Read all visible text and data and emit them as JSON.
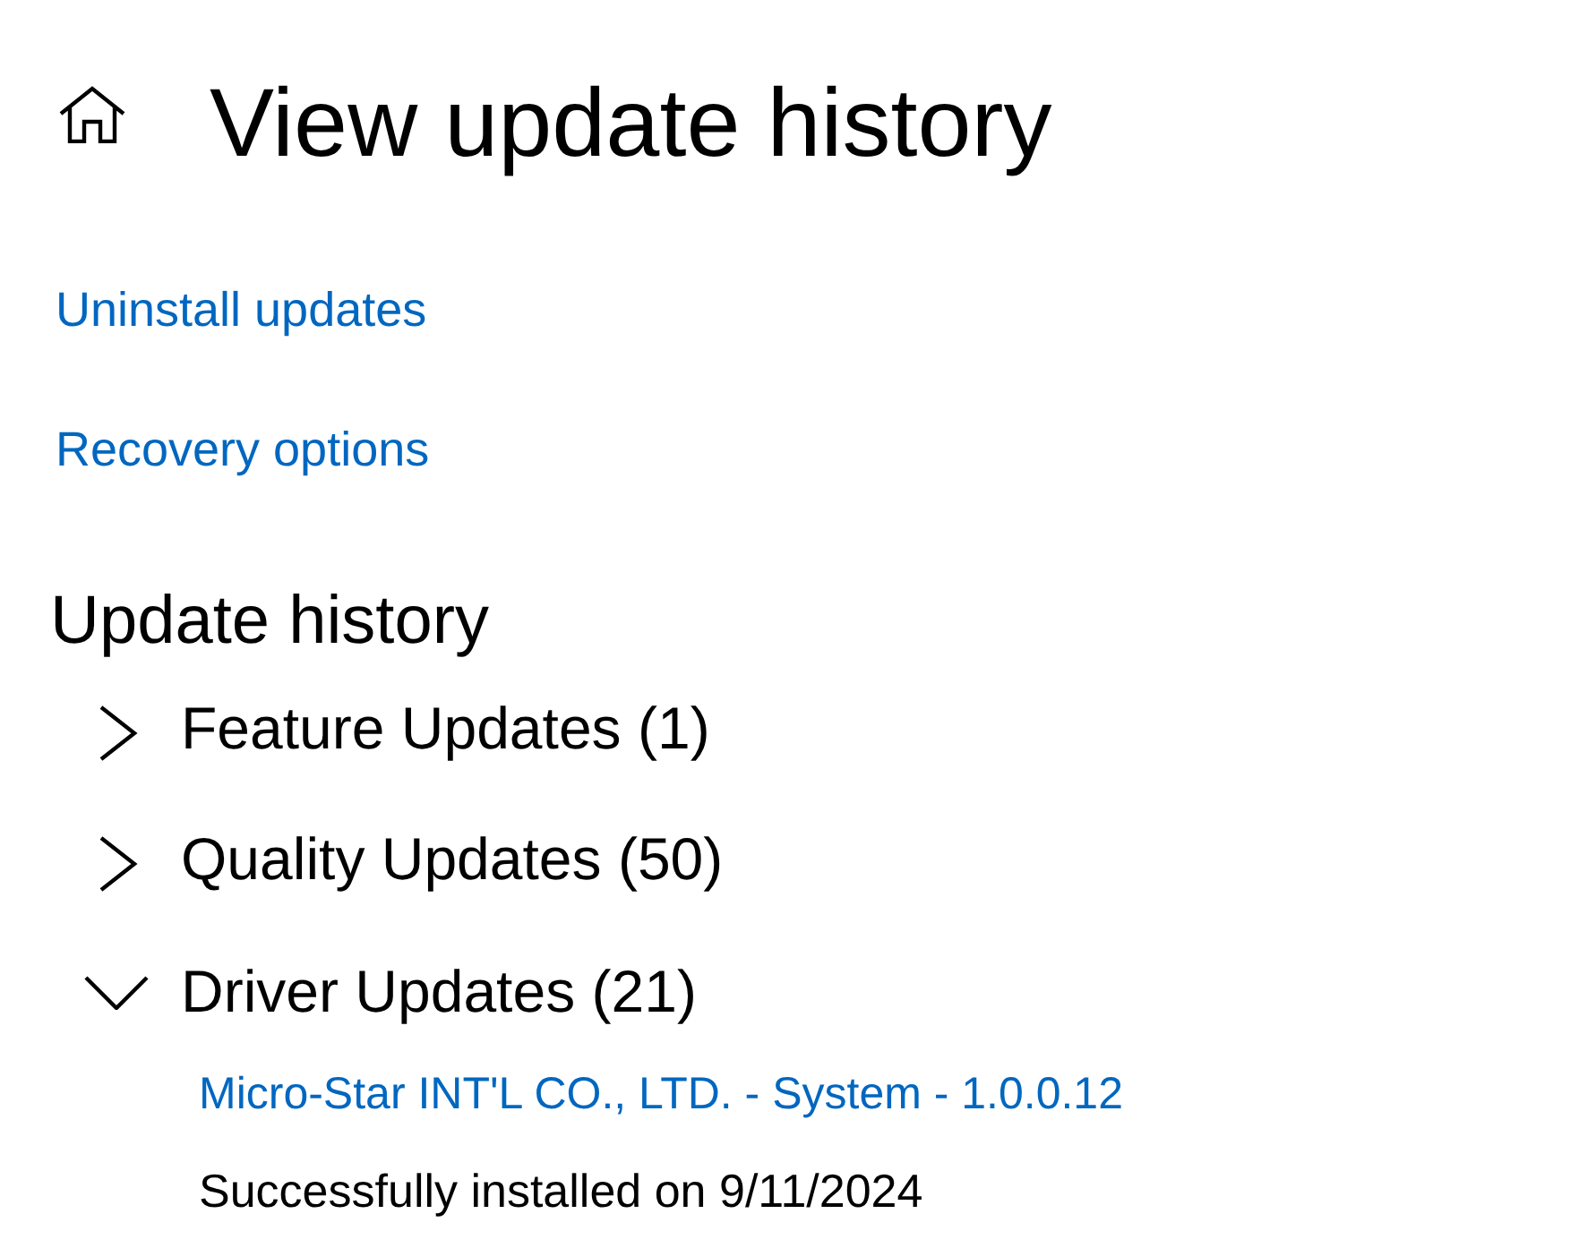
{
  "page": {
    "title": "View update history"
  },
  "links": [
    {
      "label": "Uninstall updates"
    },
    {
      "label": "Recovery options"
    }
  ],
  "update_history": {
    "heading": "Update history",
    "categories": [
      {
        "label": "Feature Updates (1)",
        "expanded": false
      },
      {
        "label": "Quality Updates (50)",
        "expanded": false
      },
      {
        "label": "Driver Updates (21)",
        "expanded": true,
        "updates": [
          {
            "name": "Micro-Star INT'L CO., LTD. - System - 1.0.0.12",
            "status": "Successfully installed on 9/11/2024"
          }
        ]
      }
    ]
  }
}
